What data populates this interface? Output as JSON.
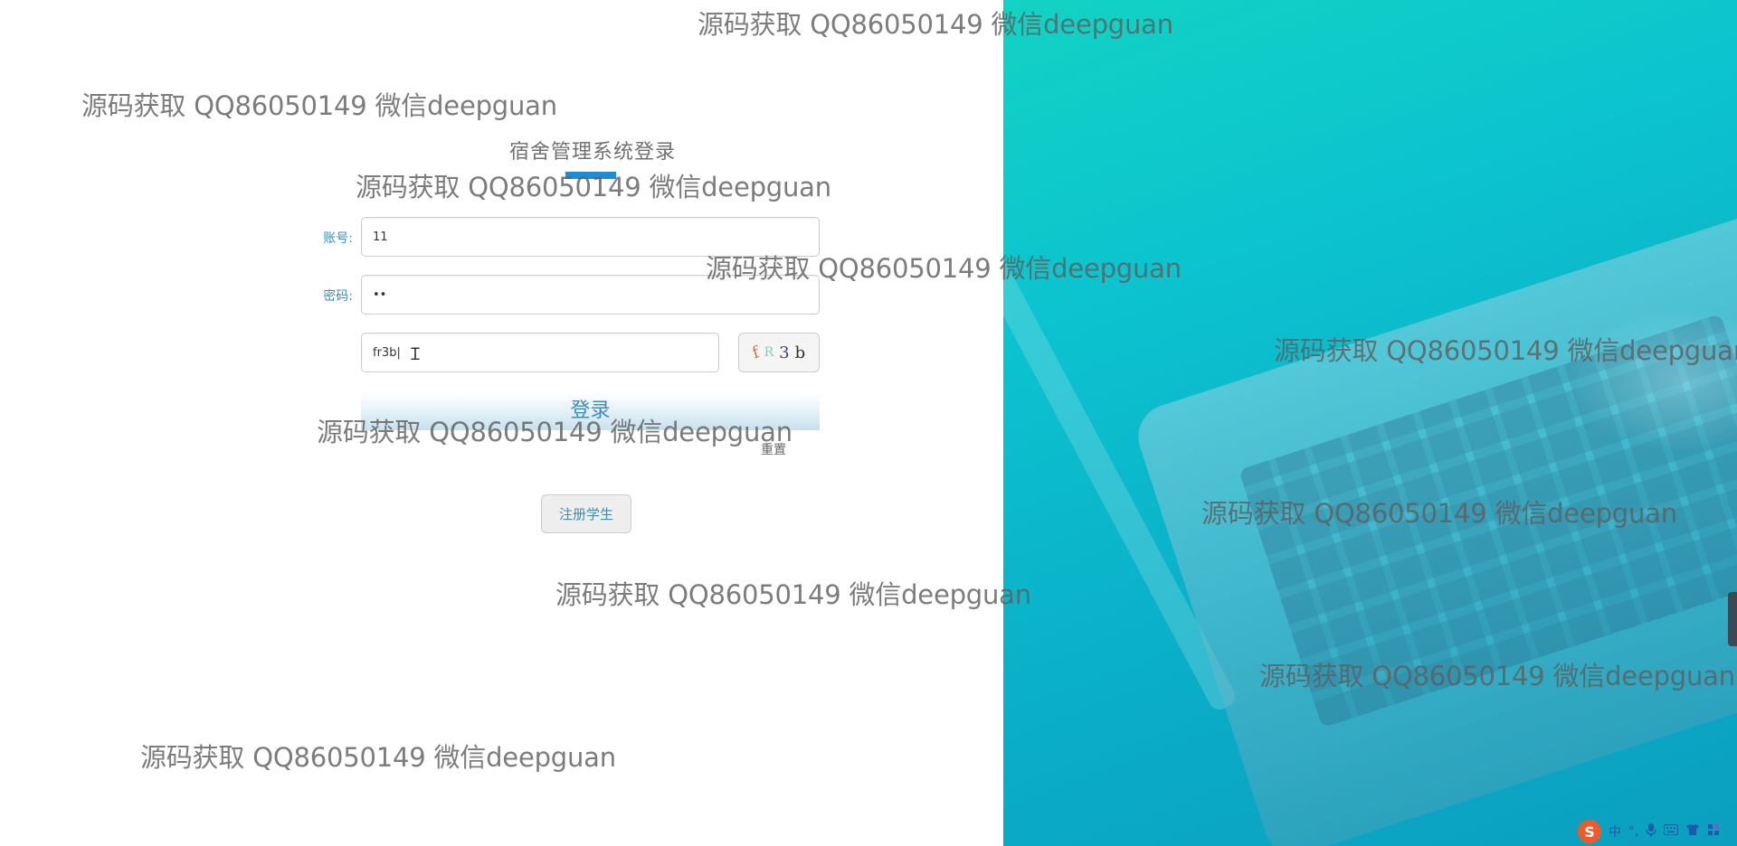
{
  "login": {
    "title": "宿舍管理系统登录",
    "account_label": "账号:",
    "account_value": "11",
    "password_label": "密码:",
    "password_value": "••",
    "captcha_input_value": "fr3b|",
    "captcha_chars": [
      "f",
      "R",
      "3",
      "b"
    ],
    "login_label": "登录",
    "reset_label": "重置",
    "register_label": "注册学生"
  },
  "watermark_text": "源码获取 QQ86050149 微信deepguan",
  "tray": {
    "logo": "S",
    "ime_mode": "中",
    "punct": "°,",
    "icons": [
      "mic-icon",
      "keyboard-icon",
      "shirt-icon",
      "grid-icon"
    ]
  },
  "colors": {
    "accent": "#1a8fd4",
    "label": "#3f8fae",
    "hero_gradient": [
      "#12d3c4",
      "#0b9fc0"
    ]
  }
}
